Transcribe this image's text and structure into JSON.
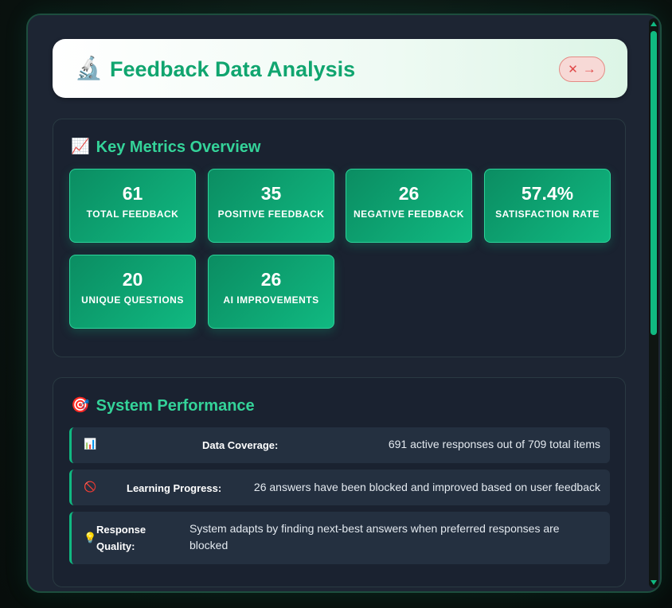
{
  "header": {
    "icon": "🔬",
    "title": "Feedback Data Analysis",
    "close_x": "✕",
    "close_arrow": "→"
  },
  "metrics": {
    "icon": "📈",
    "title": "Key Metrics Overview",
    "cards": [
      {
        "value": "61",
        "label": "TOTAL FEEDBACK"
      },
      {
        "value": "35",
        "label": "POSITIVE FEEDBACK"
      },
      {
        "value": "26",
        "label": "NEGATIVE FEEDBACK"
      },
      {
        "value": "57.4%",
        "label": "SATISFACTION RATE"
      },
      {
        "value": "20",
        "label": "UNIQUE QUESTIONS"
      },
      {
        "value": "26",
        "label": "AI IMPROVEMENTS"
      }
    ]
  },
  "performance": {
    "icon": "🎯",
    "title": "System Performance",
    "rows": [
      {
        "icon": "📊",
        "label": "Data Coverage:",
        "value": "691 active responses out of 709 total items"
      },
      {
        "icon": "🚫",
        "label": "Learning Progress:",
        "value": "26 answers have been blocked and improved based on user feedback"
      },
      {
        "icon": "💡",
        "label": "Response Quality:",
        "value": "System adapts by finding next-best answers when preferred responses are blocked"
      }
    ]
  },
  "colors": {
    "accent": "#10b981",
    "title_green": "#10a56f",
    "section_title": "#34d399",
    "modal_bg": "#1d2533",
    "close_red": "#e04848"
  }
}
